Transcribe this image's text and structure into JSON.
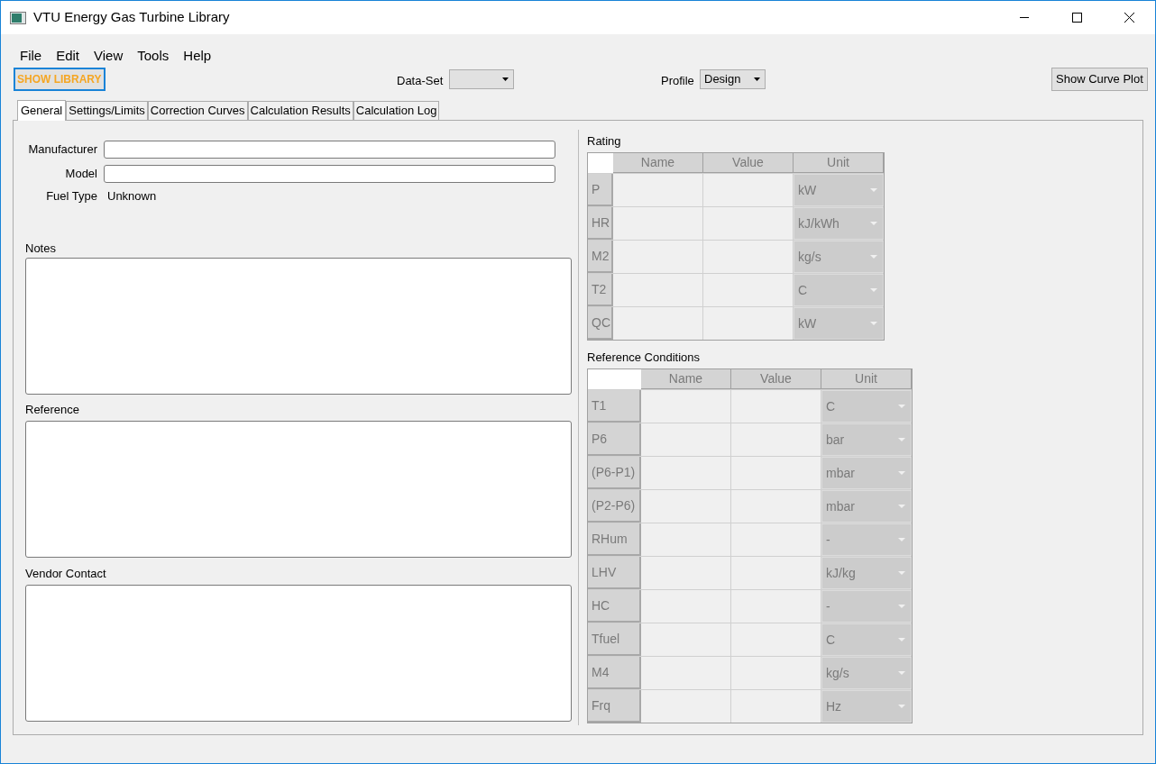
{
  "window": {
    "title": "VTU Energy Gas Turbine Library"
  },
  "menu": [
    "File",
    "Edit",
    "View",
    "Tools",
    "Help"
  ],
  "toolbar": {
    "show_library": "SHOW LIBRARY",
    "dataset_label": "Data-Set",
    "profile_label": "Profile",
    "profile_value": "Design",
    "curve_button": "Show Curve Plot"
  },
  "tabs": [
    {
      "label": "General",
      "selected": true
    },
    {
      "label": "Settings/Limits",
      "selected": false
    },
    {
      "label": "Correction Curves",
      "selected": false
    },
    {
      "label": "Calculation Results",
      "selected": false
    },
    {
      "label": "Calculation Log",
      "selected": false
    }
  ],
  "general": {
    "manufacturer_label": "Manufacturer",
    "model_label": "Model",
    "fuel_type_label": "Fuel Type",
    "fuel_type_value": "Unknown",
    "notes_label": "Notes",
    "reference_label": "Reference",
    "vendor_contact_label": "Vendor Contact"
  },
  "rating": {
    "title": "Rating",
    "columns": [
      "Name",
      "Value",
      "Unit"
    ],
    "rows": [
      {
        "header": "P",
        "unit": "kW"
      },
      {
        "header": "HR",
        "unit": "kJ/kWh"
      },
      {
        "header": "M2",
        "unit": "kg/s"
      },
      {
        "header": "T2",
        "unit": "C"
      },
      {
        "header": "QC",
        "unit": "kW"
      }
    ]
  },
  "reference_conditions": {
    "title": "Reference Conditions",
    "columns": [
      "Name",
      "Value",
      "Unit"
    ],
    "rows": [
      {
        "header": "T1",
        "unit": "C"
      },
      {
        "header": "P6",
        "unit": "bar"
      },
      {
        "header": "(P6-P1)",
        "unit": "mbar"
      },
      {
        "header": "(P2-P6)",
        "unit": "mbar"
      },
      {
        "header": "RHum",
        "unit": "-"
      },
      {
        "header": "LHV",
        "unit": "kJ/kg"
      },
      {
        "header": "HC",
        "unit": "-"
      },
      {
        "header": "Tfuel",
        "unit": "C"
      },
      {
        "header": "M4",
        "unit": "kg/s"
      },
      {
        "header": "Frq",
        "unit": "Hz"
      }
    ]
  }
}
